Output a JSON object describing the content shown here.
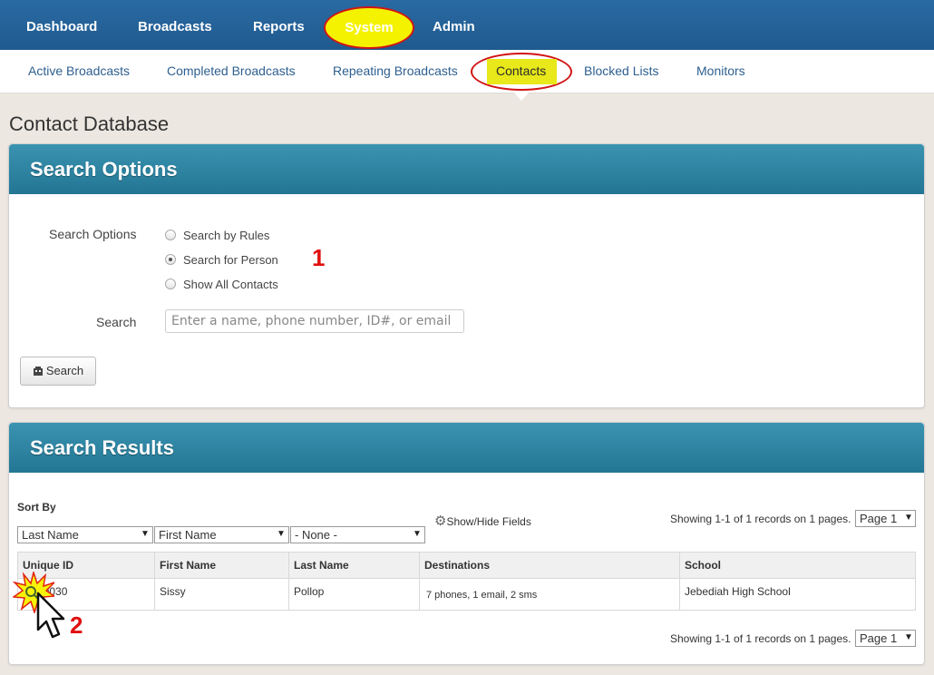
{
  "topnav": {
    "items": [
      "Dashboard",
      "Broadcasts",
      "Reports",
      "System",
      "Admin"
    ]
  },
  "subnav": {
    "items": [
      "Active Broadcasts",
      "Completed Broadcasts",
      "Repeating Broadcasts",
      "Contacts",
      "Blocked Lists",
      "Monitors"
    ]
  },
  "page_title": "Contact Database",
  "search_panel": {
    "title": "Search Options",
    "options_label": "Search Options",
    "options": [
      "Search by Rules",
      "Search for Person",
      "Show All Contacts"
    ],
    "search_label": "Search",
    "search_placeholder": "Enter a name, phone number, ID#, or email",
    "search_button": "Search"
  },
  "results_panel": {
    "title": "Search Results",
    "sort_by_label": "Sort By",
    "sort_selects": [
      "Last Name",
      "First Name",
      "- None -"
    ],
    "show_hide_fields": "Show/Hide Fields",
    "showing_text": "Showing 1-1 of 1 records on 1 pages.",
    "page_select": "Page 1",
    "columns": [
      "Unique ID",
      "First Name",
      "Last Name",
      "Destinations",
      "School"
    ],
    "rows": [
      {
        "id": "30030",
        "first": "Sissy",
        "last": "Pollop",
        "destinations": "7 phones, 1 email, 2 sms",
        "school": "Jebediah High School"
      }
    ]
  },
  "annotations": [
    "1",
    "2"
  ],
  "colors": {
    "nav_blue": "#1f5a8e",
    "panel_head": "#2b7f9c",
    "highlight_yellow": "#f5f200",
    "highlight_red": "#d21414"
  }
}
